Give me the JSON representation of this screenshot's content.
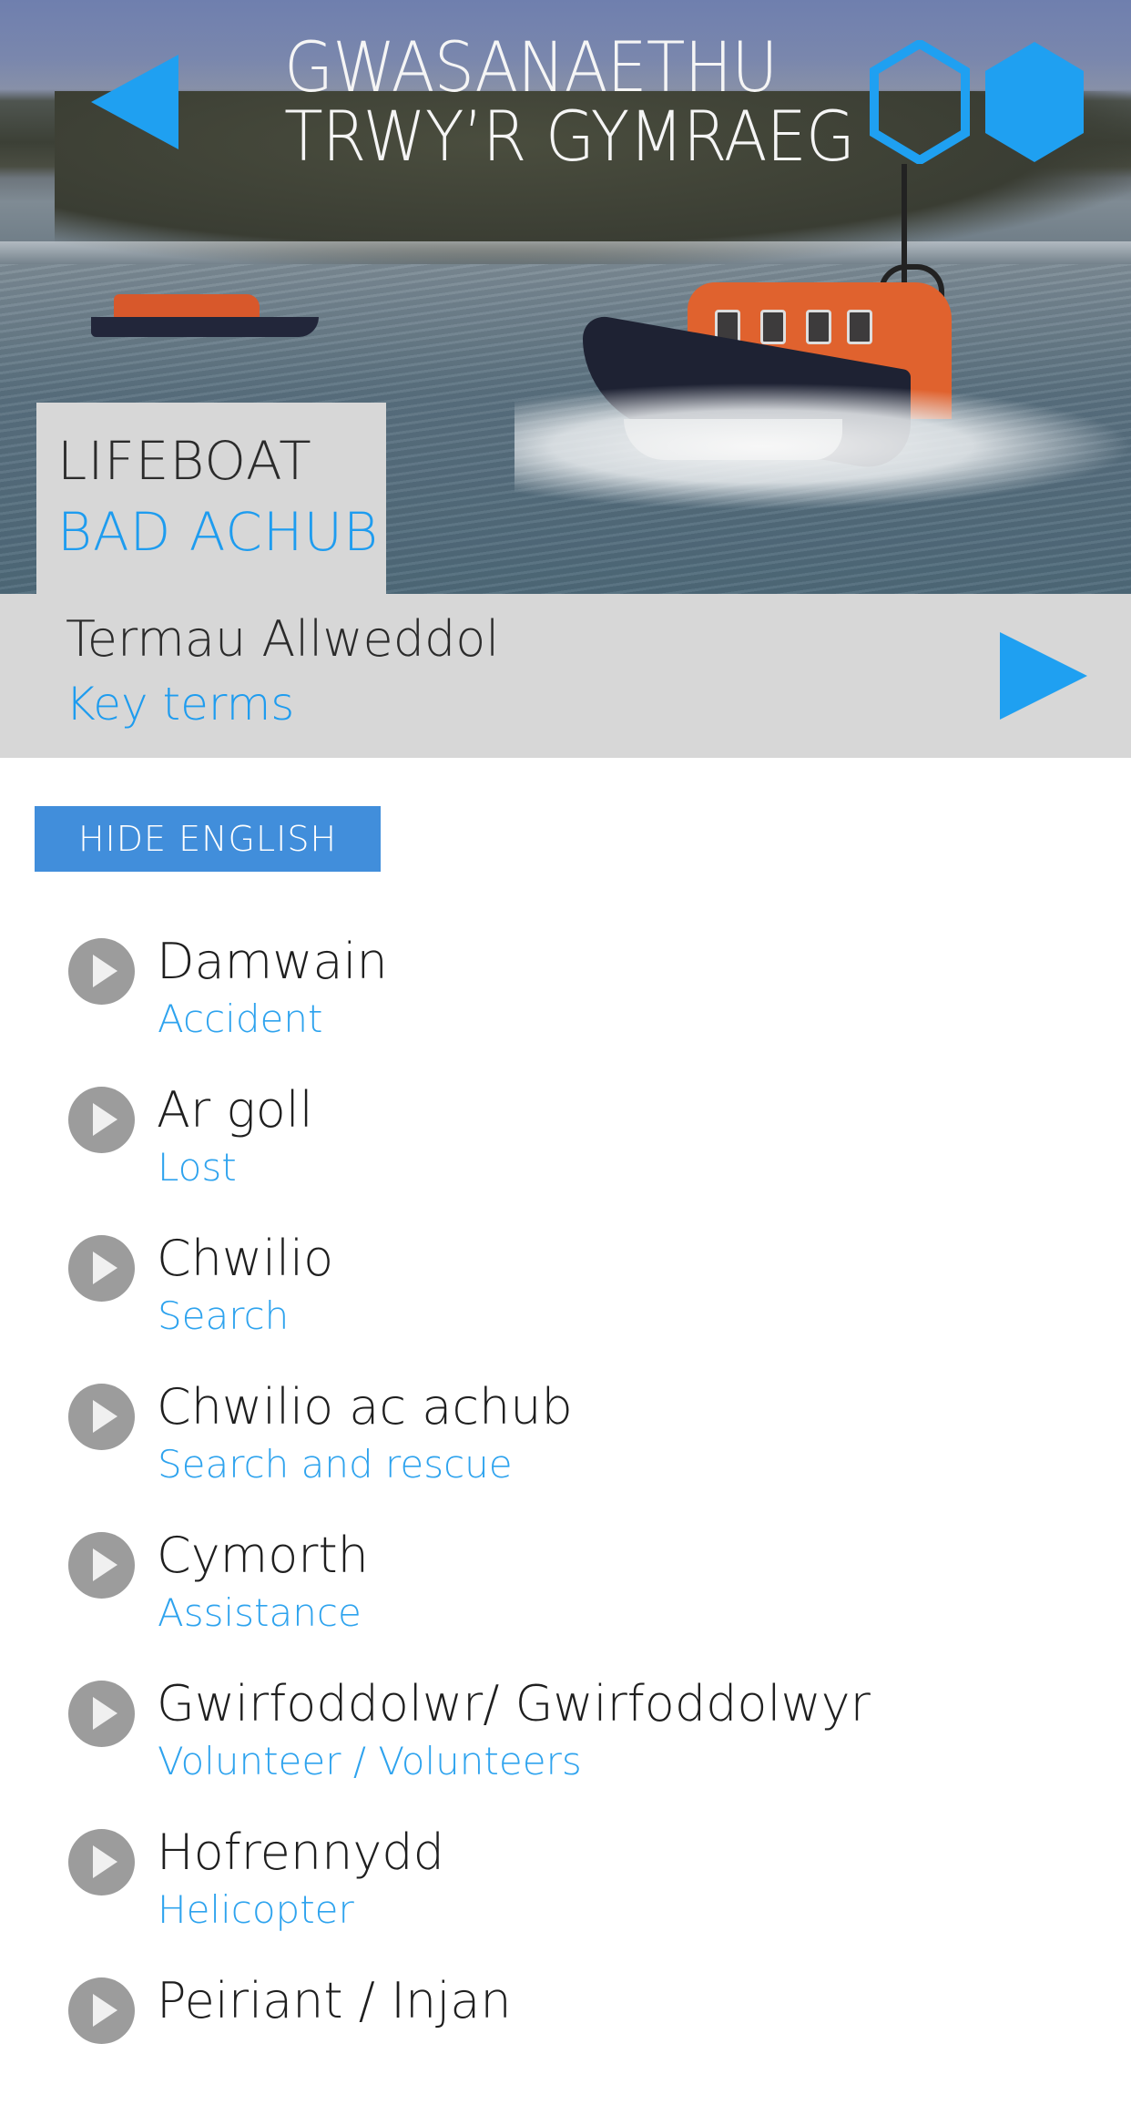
{
  "header": {
    "brand_line1": "GWASANAETHU",
    "brand_line2": "TRWY’R GYMRAEG",
    "back_icon": "triangle-left",
    "logo_icon": "two-hexagons"
  },
  "title": {
    "english": "LIFEBOAT",
    "welsh": "BAD ACHUB"
  },
  "section": {
    "welsh": "Termau Allweddol",
    "english": "Key terms",
    "next_icon": "triangle-right"
  },
  "toggle": {
    "label": "HIDE ENGLISH"
  },
  "colors": {
    "accent": "#1fa0f1",
    "button": "#418edb",
    "panel": "#d7d7d7",
    "english_text": "#2ea3ee",
    "play_icon": "#9c9c9c"
  },
  "terms": [
    {
      "welsh": "Damwain",
      "english": "Accident"
    },
    {
      "welsh": "Ar goll",
      "english": "Lost"
    },
    {
      "welsh": "Chwilio",
      "english": "Search"
    },
    {
      "welsh": "Chwilio ac achub",
      "english": "Search and rescue"
    },
    {
      "welsh": "Cymorth",
      "english": "Assistance"
    },
    {
      "welsh": "Gwirfoddolwr/ Gwirfoddolwyr",
      "english": "Volunteer / Volunteers"
    },
    {
      "welsh": "Hofrennydd",
      "english": "Helicopter"
    },
    {
      "welsh": "Peiriant / Injan",
      "english": ""
    }
  ]
}
